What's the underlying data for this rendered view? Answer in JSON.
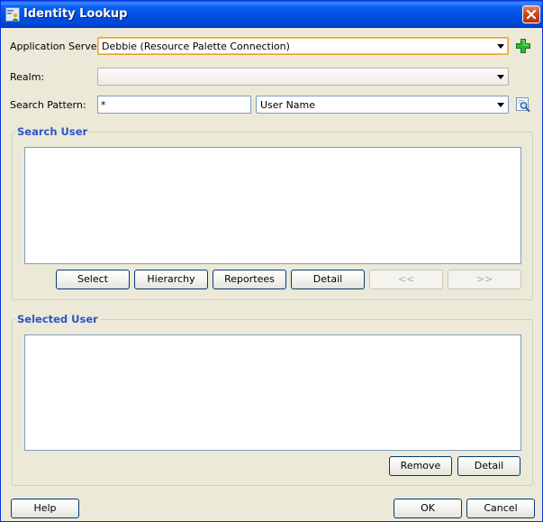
{
  "window": {
    "title": "Identity Lookup"
  },
  "form": {
    "app_server_label": "Application Server:",
    "app_server_value": "Debbie (Resource Palette Connection)",
    "realm_label": "Realm:",
    "realm_value": "",
    "search_pattern_label": "Search Pattern:",
    "search_pattern_value": "*",
    "search_by_value": "User Name"
  },
  "search_user": {
    "title": "Search User",
    "buttons": {
      "select": "Select",
      "hierarchy": "Hierarchy",
      "reportees": "Reportees",
      "detail": "Detail",
      "prev": "<<",
      "next": ">>"
    }
  },
  "selected_user": {
    "title": "Selected User",
    "buttons": {
      "remove": "Remove",
      "detail": "Detail"
    }
  },
  "footer": {
    "help": "Help",
    "ok": "OK",
    "cancel": "Cancel"
  },
  "colors": {
    "group_title": "#2c55c4",
    "add_icon": "#1fa81f",
    "focus_border": "#e3a23c"
  },
  "icons": {
    "title": "identity-lookup-icon",
    "close": "close-icon",
    "add": "add-connection-icon",
    "search": "search-icon"
  }
}
